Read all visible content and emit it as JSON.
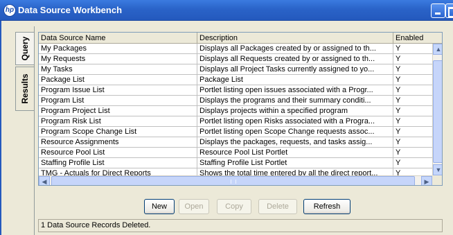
{
  "window": {
    "title": "Data Source Workbench",
    "logo_text": "hp"
  },
  "tabs": [
    {
      "label": "Query"
    },
    {
      "label": "Results"
    }
  ],
  "table": {
    "columns": [
      "Data Source Name",
      "Description",
      "Enabled"
    ],
    "rows": [
      [
        "My Packages",
        "Displays all Packages created by or assigned to th...",
        "Y"
      ],
      [
        "My Requests",
        "Displays all Requests created by or assigned to th...",
        "Y"
      ],
      [
        "My Tasks",
        "Displays all Project Tasks currently assigned to yo...",
        "Y"
      ],
      [
        "Package List",
        "Package List",
        "Y"
      ],
      [
        "Program Issue List",
        "Portlet listing open issues associated with a Progr...",
        "Y"
      ],
      [
        "Program List",
        "Displays the programs and their summary conditi...",
        "Y"
      ],
      [
        "Program Project List",
        "Displays projects within a specified program",
        "Y"
      ],
      [
        "Program Risk List",
        "Portlet listing open Risks associated with a Progra...",
        "Y"
      ],
      [
        "Program Scope Change List",
        "Portlet listing open Scope Change requests assoc...",
        "Y"
      ],
      [
        "Resource Assignments",
        "Displays the packages, requests, and tasks assig...",
        "Y"
      ],
      [
        "Resource Pool List",
        "Resource Pool List Portlet",
        "Y"
      ],
      [
        "Staffing Profile List",
        "Staffing Profile List Portlet",
        "Y"
      ],
      [
        "TMG - Actuals for Direct Reports",
        "Shows the total time entered by all the direct report...",
        "Y"
      ]
    ]
  },
  "buttons": {
    "new": "New",
    "open": "Open",
    "copy": "Copy",
    "delete": "Delete",
    "refresh": "Refresh"
  },
  "status": {
    "message": "1 Data Source Records Deleted."
  },
  "icons": {
    "scroll_up": "▲",
    "scroll_down": "▼",
    "scroll_left": "◀",
    "scroll_right": "▶"
  },
  "colors": {
    "titlebar": "#2459bd",
    "face": "#ece9d8",
    "grid_border": "#7f9db9"
  }
}
